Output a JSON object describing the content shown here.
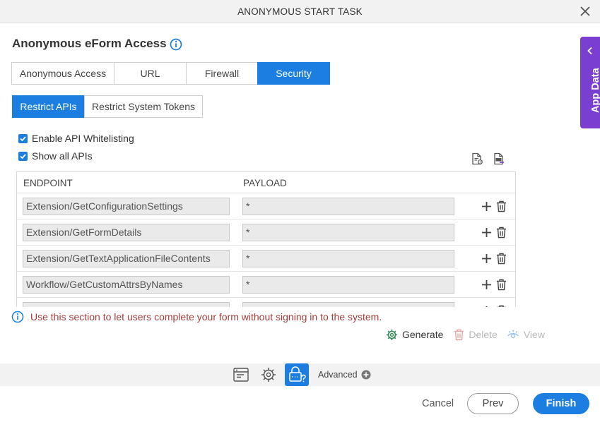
{
  "window": {
    "title": "ANONYMOUS START TASK"
  },
  "page": {
    "heading": "Anonymous eForm Access"
  },
  "tabs": [
    {
      "label": "Anonymous Access",
      "active": false
    },
    {
      "label": "URL",
      "active": false
    },
    {
      "label": "Firewall",
      "active": false
    },
    {
      "label": "Security",
      "active": true
    }
  ],
  "subtabs": [
    {
      "label": "Restrict APIs",
      "active": true
    },
    {
      "label": "Restrict System Tokens",
      "active": false
    }
  ],
  "options": {
    "enable_whitelisting": {
      "label": "Enable API Whitelisting",
      "checked": true
    },
    "show_all_apis": {
      "label": "Show all APIs",
      "checked": true
    }
  },
  "grid": {
    "columns": [
      "ENDPOINT",
      "PAYLOAD"
    ],
    "rows": [
      {
        "endpoint": "Extension/GetConfigurationSettings",
        "payload": "*"
      },
      {
        "endpoint": "Extension/GetFormDetails",
        "payload": "*"
      },
      {
        "endpoint": "Extension/GetTextApplicationFileContents",
        "payload": "*"
      },
      {
        "endpoint": "Workflow/GetCustomAttrsByNames",
        "payload": "*"
      },
      {
        "endpoint": "",
        "payload": ""
      }
    ]
  },
  "note": "Use this section to let users complete your form without signing in to the system.",
  "actions": {
    "generate": "Generate",
    "delete": "Delete",
    "view": "View"
  },
  "bottombar": {
    "advanced": "Advanced"
  },
  "footer": {
    "cancel": "Cancel",
    "prev": "Prev",
    "finish": "Finish"
  },
  "sidepanel": {
    "label": "App Data"
  },
  "colors": {
    "accent": "#1b7ee0",
    "sidepanel": "#7a3fd1",
    "note": "#a33d3d",
    "generate": "#2e8b57",
    "disabled": "#b8b8b8"
  }
}
